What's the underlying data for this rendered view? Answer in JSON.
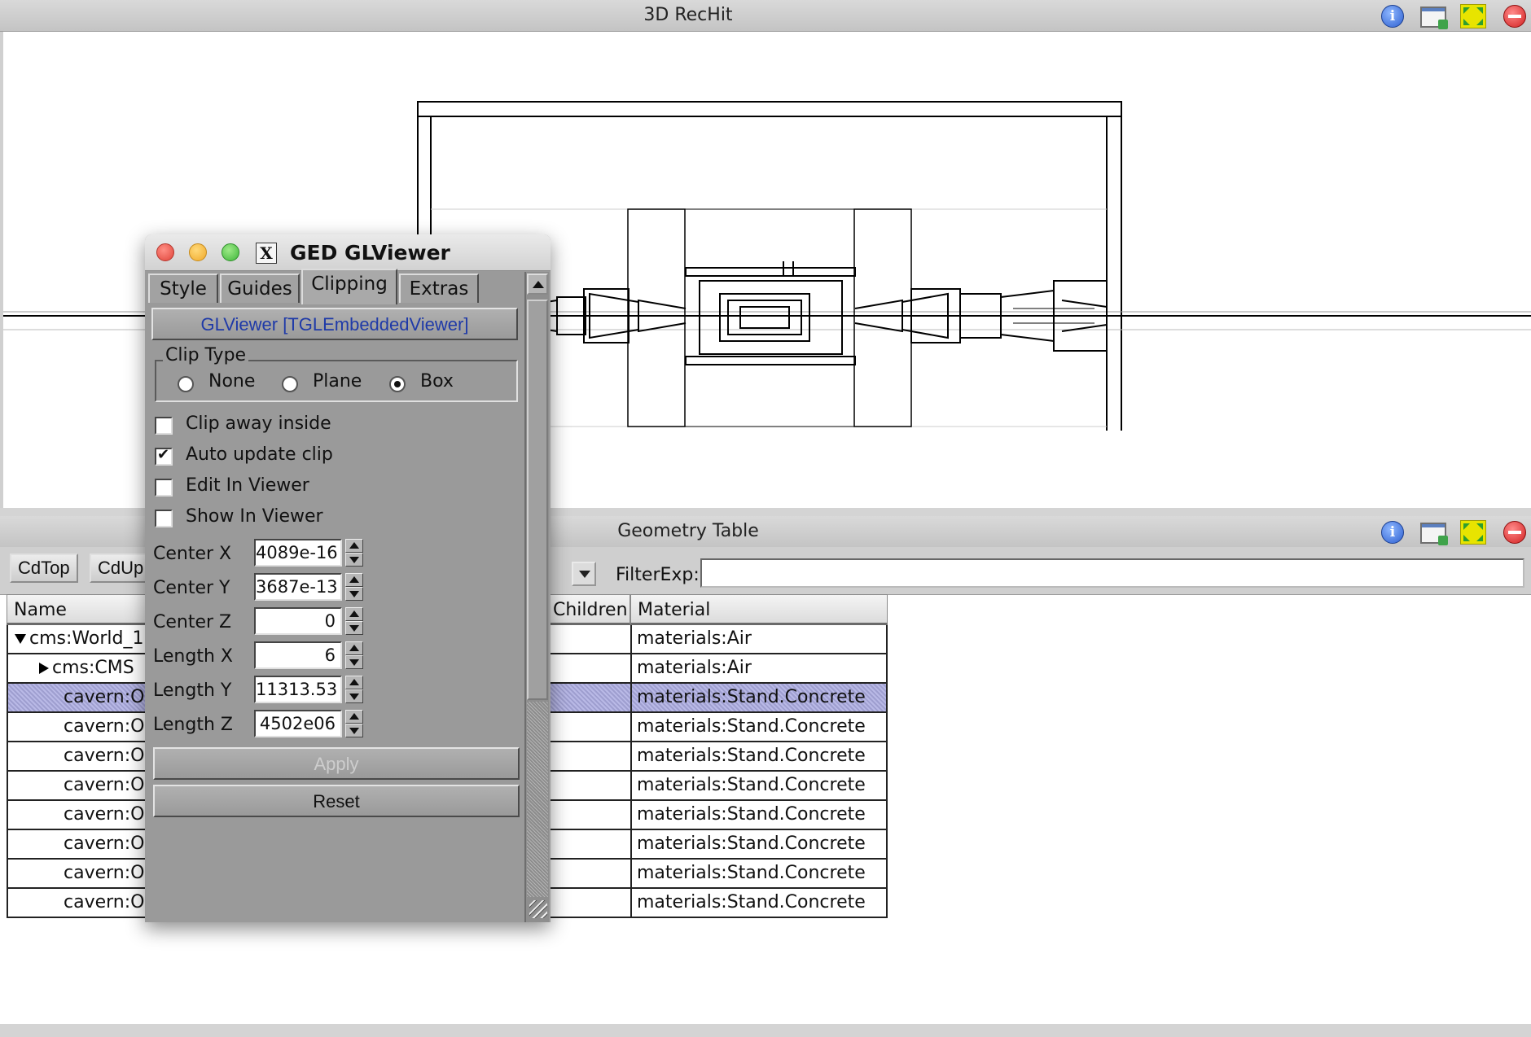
{
  "viewer_panel": {
    "title": "3D RecHit"
  },
  "table_panel": {
    "title": "Geometry Table",
    "buttons": [
      "CdTop",
      "CdUp"
    ],
    "filter_label": "FilterExp:",
    "filter_value": "",
    "columns": [
      "Name",
      "Children",
      "Material"
    ],
    "rows": [
      {
        "name": "cms:World_1",
        "expand": "down",
        "indent": 0,
        "material": "materials:Air",
        "selected": false
      },
      {
        "name": "cms:CMS",
        "expand": "right",
        "indent": 1,
        "material": "materials:Air",
        "selected": false
      },
      {
        "name": "cavern:O",
        "expand": "",
        "indent": 2,
        "material": "materials:Stand.Concrete",
        "selected": true
      },
      {
        "name": "cavern:O",
        "expand": "",
        "indent": 2,
        "material": "materials:Stand.Concrete",
        "selected": false
      },
      {
        "name": "cavern:O",
        "expand": "",
        "indent": 2,
        "material": "materials:Stand.Concrete",
        "selected": false
      },
      {
        "name": "cavern:O",
        "expand": "",
        "indent": 2,
        "material": "materials:Stand.Concrete",
        "selected": false
      },
      {
        "name": "cavern:O",
        "expand": "",
        "indent": 2,
        "material": "materials:Stand.Concrete",
        "selected": false
      },
      {
        "name": "cavern:O",
        "expand": "",
        "indent": 2,
        "material": "materials:Stand.Concrete",
        "selected": false
      },
      {
        "name": "cavern:O",
        "expand": "",
        "indent": 2,
        "material": "materials:Stand.Concrete",
        "selected": false
      },
      {
        "name": "cavern:O",
        "expand": "",
        "indent": 2,
        "material": "materials:Stand.Concrete",
        "selected": false
      }
    ]
  },
  "ged": {
    "title": "GED GLViewer",
    "tabs": [
      "Style",
      "Guides",
      "Clipping",
      "Extras"
    ],
    "active_tab": "Clipping",
    "object_button": "GLViewer [TGLEmbeddedViewer]",
    "clip_type": {
      "label": "Clip Type",
      "options": [
        "None",
        "Plane",
        "Box"
      ],
      "selected": "Box"
    },
    "checkboxes": [
      {
        "label": "Clip away inside",
        "checked": false
      },
      {
        "label": "Auto update clip",
        "checked": true
      },
      {
        "label": "Edit In Viewer",
        "checked": false
      },
      {
        "label": "Show In Viewer",
        "checked": false
      }
    ],
    "fields": [
      {
        "label": "Center X",
        "value": "4089e-16"
      },
      {
        "label": "Center Y",
        "value": "3687e-13"
      },
      {
        "label": "Center Z",
        "value": "0"
      },
      {
        "label": "Length X",
        "value": "6"
      },
      {
        "label": "Length Y",
        "value": "11313.53"
      },
      {
        "label": "Length Z",
        "value": "4502e06"
      }
    ],
    "apply_label": "Apply",
    "reset_label": "Reset"
  },
  "icons": [
    "info-icon",
    "undock-icon",
    "maximize-icon",
    "close-icon",
    "x11-icon"
  ],
  "colors": {
    "selected_row": "#b9b9e6",
    "object_button_text": "#1f3aa8",
    "dialog_bg": "#9a9a9a"
  }
}
